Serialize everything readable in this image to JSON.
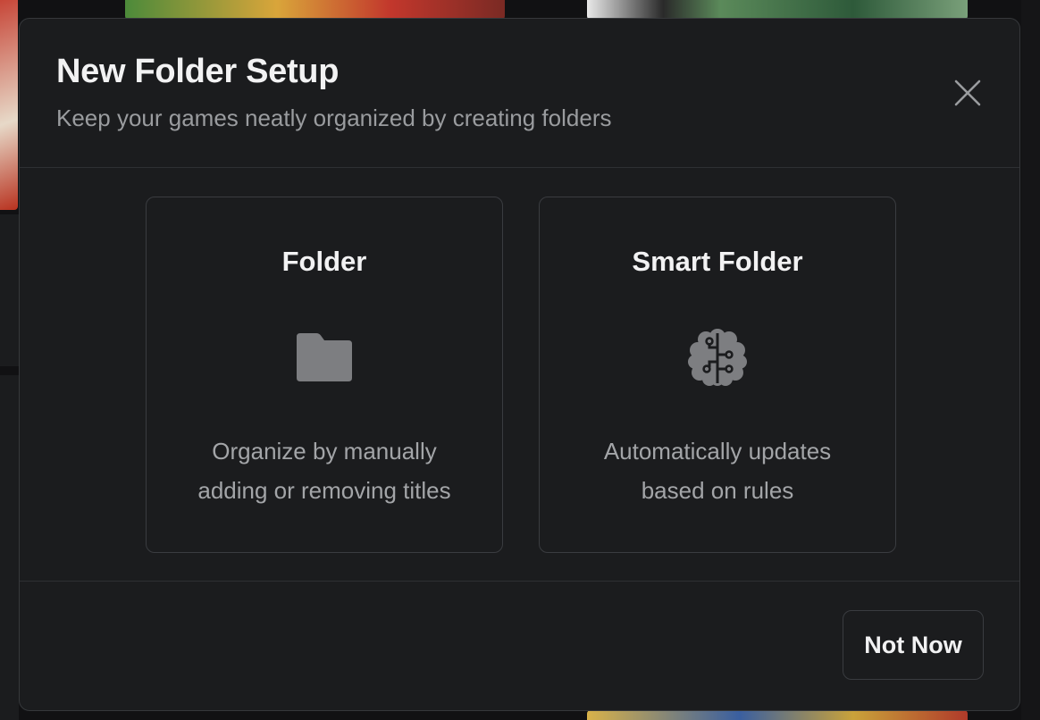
{
  "modal": {
    "title": "New Folder Setup",
    "subtitle": "Keep your games neatly organized by creating folders",
    "close_icon": "close-icon"
  },
  "options": [
    {
      "title": "Folder",
      "icon": "folder-icon",
      "description_line1": "Organize by manually",
      "description_line2": "adding or removing titles"
    },
    {
      "title": "Smart Folder",
      "icon": "brain-circuit-icon",
      "description_line1": "Automatically updates",
      "description_line2": "based on rules"
    }
  ],
  "footer": {
    "not_now_label": "Not Now"
  },
  "colors": {
    "modal_bg": "#1b1c1e",
    "border": "#3a3c40",
    "text_primary": "#f2f2f3",
    "text_secondary": "#9a9c9f",
    "icon": "#7d7e81"
  }
}
